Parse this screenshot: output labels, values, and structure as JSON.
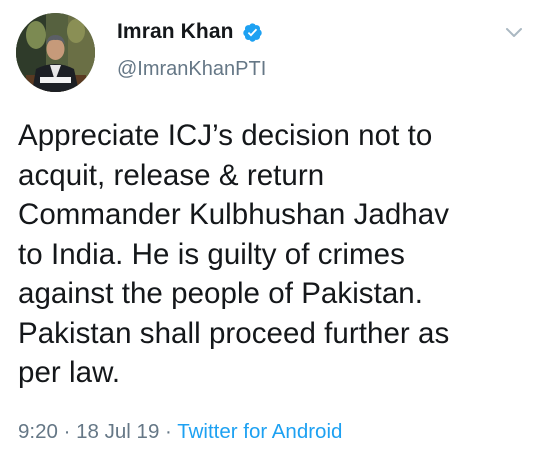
{
  "profile": {
    "display_name": "Imran Khan",
    "handle": "@ImranKhanPTI",
    "verified_icon": "verified-badge-icon",
    "avatar_icon": "profile-photo"
  },
  "menu": {
    "caret_icon": "chevron-down-icon"
  },
  "tweet": {
    "text": "Appreciate ICJ’s decision not to\nacquit, release & return\nCommander Kulbhushan Jadhav\nto India. He is guilty of crimes\nagainst the people of Pakistan.\nPakistan shall proceed further as\nper law."
  },
  "meta": {
    "time": "9:20",
    "date": "18 Jul 19",
    "separator": "·",
    "source": "Twitter for Android"
  },
  "colors": {
    "text": "#14171a",
    "secondary": "#657786",
    "accent": "#1da1f2"
  }
}
